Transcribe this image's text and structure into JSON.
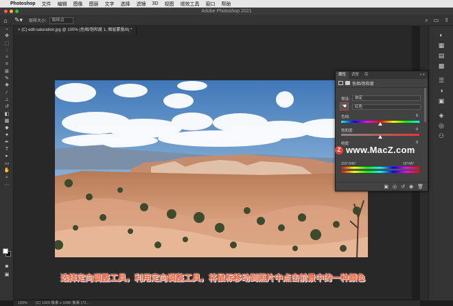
{
  "menubar": {
    "apple": "",
    "app_name": "Photoshop",
    "items": [
      "文件",
      "编辑",
      "图像",
      "图层",
      "文字",
      "选择",
      "滤镜",
      "3D",
      "视图",
      "增效工具",
      "窗口",
      "帮助"
    ]
  },
  "titlebar": {
    "title": "Adobe Photoshop 2021"
  },
  "options": {
    "sample_label": "取样大小:",
    "sample_value": "取样点"
  },
  "document": {
    "tab_title": "(C) edit-saturation.jpg @ 100% (色相/饱和度 1, 图层蒙版/8) *"
  },
  "panel": {
    "tabs": [
      "属性",
      "调整",
      "库"
    ],
    "active_tab": "属性",
    "header": "色相/饱和度",
    "preset_label": "预设:",
    "preset_value": "自定",
    "channel_value": "红色",
    "hue_label": "色相:",
    "hue_value": "0",
    "hue_level": 0.5,
    "sat_label": "饱和度:",
    "sat_value": "0",
    "sat_level": 0.5,
    "light_label": "明度:",
    "light_value": "0",
    "light_level": 0.5,
    "range_left": "315°/345°",
    "range_right": "15°/45°"
  },
  "watermark": {
    "logo_letter": "Z",
    "text": "www.MacZ.com"
  },
  "caption": "选择定向调整工具，利用定向调整工具，将鼠标移动到照片中点击前景中的一种颜色",
  "status": {
    "zoom": "100%",
    "info": "(C) 1920 像素 x 1080 像素 (72..."
  },
  "colors": {
    "accent": "#e23a2a",
    "caption": "#f45a38",
    "bg": "#282828"
  }
}
